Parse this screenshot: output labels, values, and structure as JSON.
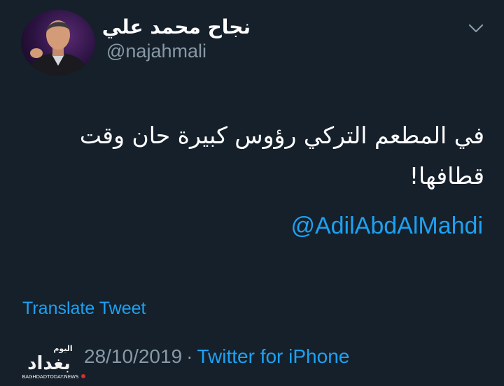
{
  "user": {
    "display_name": "نجاح محمد علي",
    "handle": "@najahmali"
  },
  "tweet": {
    "text": "في المطعم التركي رؤوس كبيرة حان وقت قطافها!",
    "mention": "@AdilAbdAlMahdi",
    "translate_label": "Translate Tweet",
    "date": "28/10/2019",
    "separator": "·",
    "source": "Twitter for iPhone"
  },
  "watermark": {
    "top_word": "اليوم",
    "main_word": "بغداد",
    "url": "BAGHDADTODAY.NEWS"
  },
  "icons": {
    "menu": "chevron-down-icon"
  },
  "colors": {
    "background": "#15202b",
    "link": "#1da1f2",
    "secondary_text": "#8899a6",
    "primary_text": "#ffffff"
  }
}
